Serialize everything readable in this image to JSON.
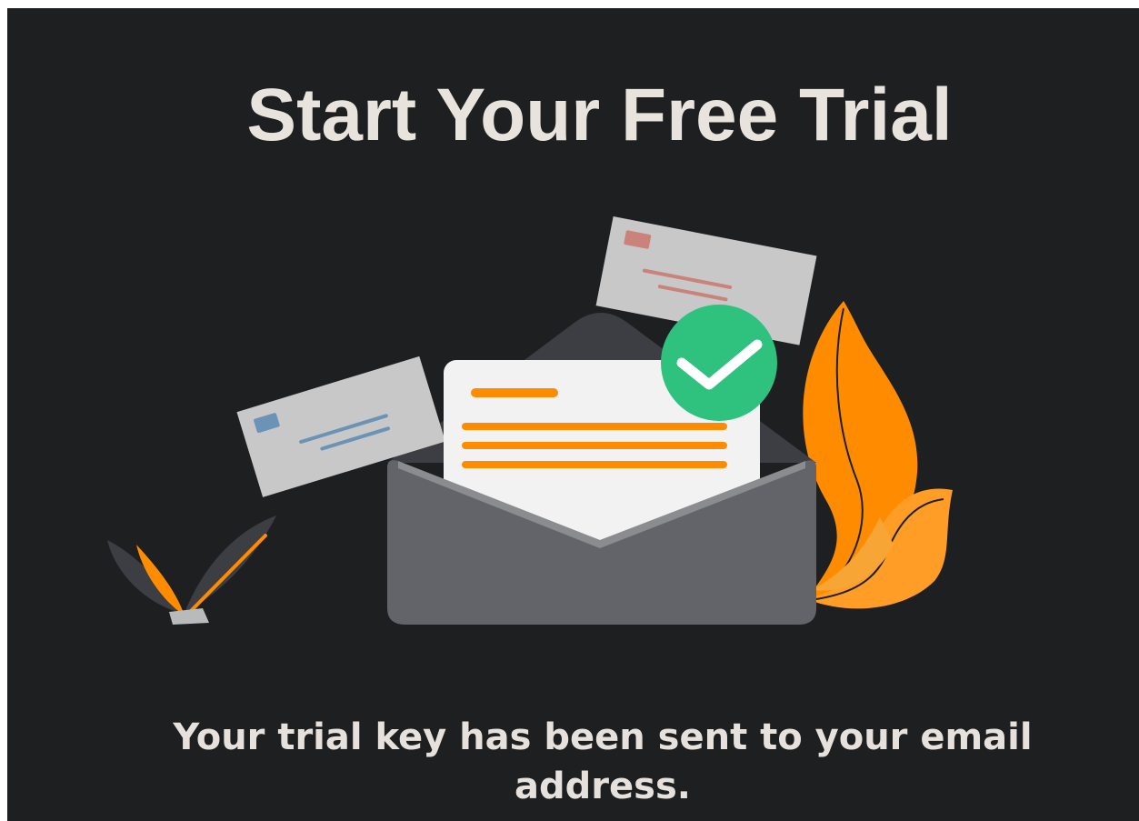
{
  "page": {
    "title": "Start Your Free Trial",
    "message": "Your trial key has been sent to your email address."
  },
  "illustration": {
    "name": "email-sent-illustration",
    "icons": [
      "envelope-icon",
      "letter-icon",
      "check-icon",
      "flying-letter-icon",
      "plant-leaf-icon"
    ]
  },
  "colors": {
    "background": "#1d1f20",
    "title_text": "#e9e3dd",
    "accent_orange": "#ff8c00",
    "success_green": "#2ec27e",
    "envelope_gray": "#626469"
  }
}
